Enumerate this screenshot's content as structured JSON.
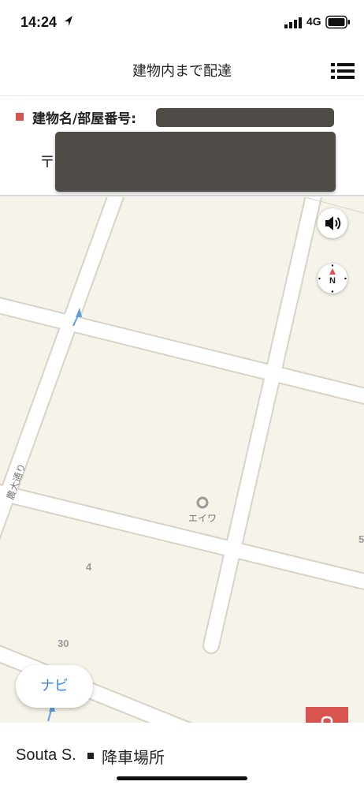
{
  "status_bar": {
    "time": "14:24",
    "network": "4G"
  },
  "header": {
    "title": "建物内まで配達",
    "menu_icon": "list-icon"
  },
  "info": {
    "building_label": "建物名/部屋番号:",
    "postal_mark": "〒",
    "accent_color": "#d9534f"
  },
  "map": {
    "street_label": "農大通り",
    "place_label": "エイワ",
    "block_numbers": [
      "4",
      "30",
      "5"
    ],
    "background_color": "#f6f3ea"
  },
  "controls": {
    "sound_icon": "speaker-icon",
    "compass_icon": "compass-icon",
    "compass_letter": "N",
    "navi_label": "ナビ",
    "bag_icon": "shopping-bag-icon"
  },
  "bottom": {
    "customer_name": "Souta S.",
    "dropoff_label": "降車場所"
  }
}
